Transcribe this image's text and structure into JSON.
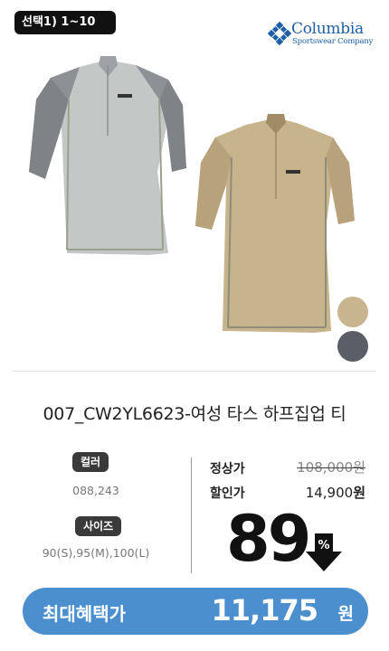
{
  "badge": {
    "selection_label": "선택1) 1~10"
  },
  "brand": {
    "name": "Columbia",
    "sub": "Sportswear Company",
    "color": "#1f5fa6"
  },
  "product": {
    "title": "007_CW2YL6623-여성 타스 하프집업 티",
    "swatches": [
      {
        "name": "beige",
        "color": "#c8b48f"
      },
      {
        "name": "charcoal",
        "color": "#5a5f67"
      }
    ]
  },
  "options": {
    "color_label": "컬러",
    "color_value": "088,243",
    "size_label": "사이즈",
    "size_value": "90(S),95(M),100(L)"
  },
  "pricing": {
    "regular_label": "정상가",
    "regular_price": "108,000원",
    "sale_label": "할인가",
    "sale_price": "14,900",
    "sale_unit": "원",
    "discount_rate": "89",
    "discount_symbol": "%"
  },
  "benefit": {
    "label": "최대혜택가",
    "price": "11,175",
    "unit": "원",
    "color": "#4c8fcf"
  }
}
